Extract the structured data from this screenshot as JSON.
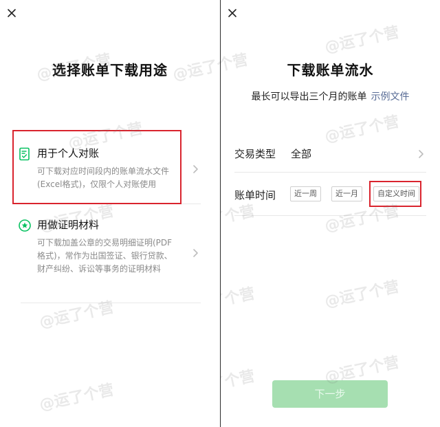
{
  "left": {
    "title": "选择账单下载用途",
    "options": [
      {
        "title": "用于个人对账",
        "desc": "可下载对应时间段内的账单流水文件(Excel格式)，仅限个人对账使用"
      },
      {
        "title": "用做证明材料",
        "desc": "可下载加盖公章的交易明细证明(PDF格式)，常作为出国签证、银行贷款、财产纠纷、诉讼等事务的证明材料"
      }
    ]
  },
  "right": {
    "title": "下载账单流水",
    "subtitle": "最长可以导出三个月的账单",
    "example_link": "示例文件",
    "type_label": "交易类型",
    "type_value": "全部",
    "time_label": "账单时间",
    "time_options": [
      "近一周",
      "近一月",
      "自定义时间"
    ],
    "next_button": "下一步"
  },
  "watermark": "@运了个营",
  "colors": {
    "accent_green": "#07c160",
    "button_disabled": "#a6dfb1",
    "highlight_red": "#d9232d",
    "link_blue": "#576b95"
  },
  "icons": [
    "close-icon",
    "document-check-icon",
    "star-badge-icon",
    "chevron-right-icon"
  ]
}
